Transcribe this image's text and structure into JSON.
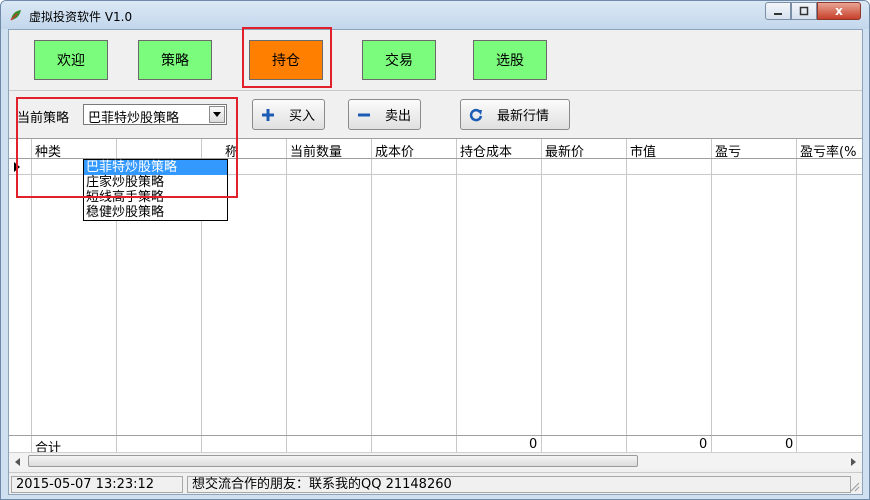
{
  "window": {
    "title": "虚拟投资软件 V1.0",
    "min_icon": "minimize-icon",
    "max_icon": "maximize-icon",
    "close_label": "x"
  },
  "nav": {
    "items": [
      {
        "label": "欢迎",
        "active": false
      },
      {
        "label": "策略",
        "active": false
      },
      {
        "label": "持仓",
        "active": true
      },
      {
        "label": "交易",
        "active": false
      },
      {
        "label": "选股",
        "active": false
      }
    ],
    "active_color": "#ff8000",
    "inactive_color": "#7cfc7c"
  },
  "toolbar": {
    "strategy_label": "当前策略",
    "strategy_selected": "巴菲特炒股策略",
    "strategy_options": [
      "巴菲特炒股策略",
      "庄家炒股策略",
      "短线高手策略",
      "稳健炒股策略"
    ],
    "buy_label": "买入",
    "sell_label": "卖出",
    "refresh_label": "最新行情"
  },
  "grid": {
    "columns": [
      "种类",
      "",
      "称",
      "当前数量",
      "成本价",
      "持仓成本",
      "最新价",
      "市值",
      "盈亏",
      "盈亏率(%"
    ],
    "totals": {
      "label": "合计",
      "cost_total": "0",
      "market_value_total": "0",
      "pnl_total": "0"
    }
  },
  "status": {
    "datetime": "2015-05-07 13:23:12",
    "message": "想交流合作的朋友：联系我的QQ 21148260"
  },
  "highlight_color": "#e0202a"
}
